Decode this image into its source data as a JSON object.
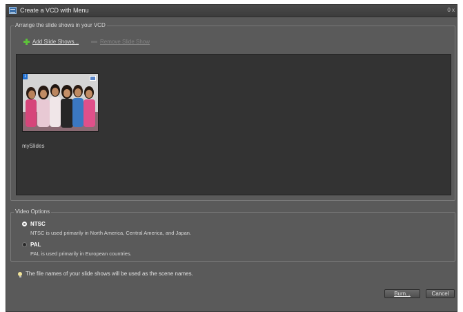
{
  "window": {
    "title": "Create a VCD with Menu",
    "controls": "0 x"
  },
  "arrange": {
    "legend": "Arrange the slide shows in your VCD",
    "add_label": "Add Slide Shows...",
    "remove_label": "Remove Slide Show",
    "slides": [
      {
        "name": "mySlides",
        "badge": "1"
      }
    ]
  },
  "video_options": {
    "legend": "Video Options",
    "options": [
      {
        "title": "NTSC",
        "description": "NTSC is used primarily in North America, Central America, and Japan.",
        "selected": true
      },
      {
        "title": "PAL",
        "description": "PAL is used primarily in European countries.",
        "selected": false
      }
    ]
  },
  "info": {
    "icon": "lightbulb-icon",
    "text": "The file names of your slide shows will be used as the scene names."
  },
  "buttons": {
    "burn": "Burn...",
    "cancel": "Cancel"
  }
}
